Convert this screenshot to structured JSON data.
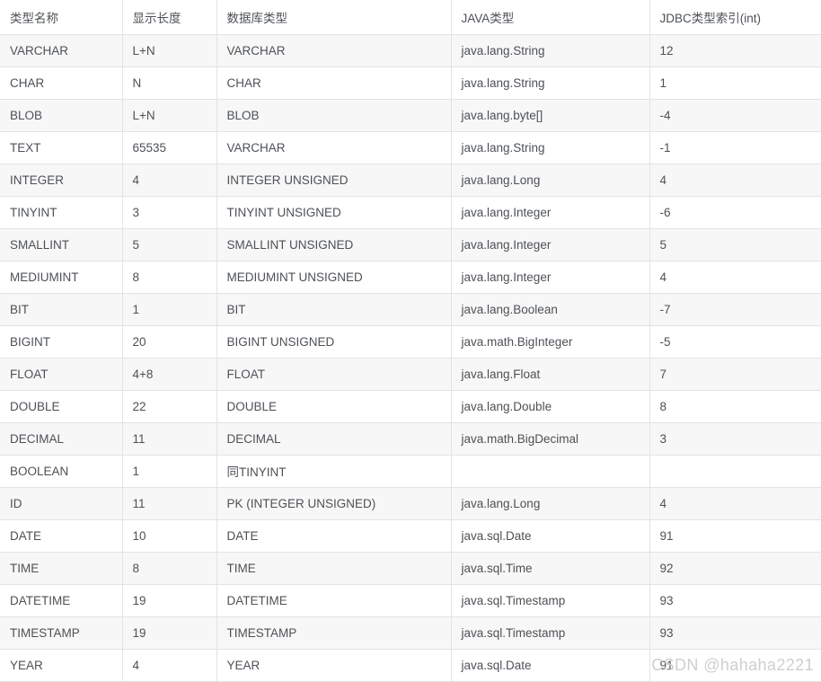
{
  "table": {
    "columns": [
      "类型名称",
      "显示长度",
      "数据库类型",
      "JAVA类型",
      "JDBC类型索引(int)"
    ],
    "rows": [
      {
        "type_name": "VARCHAR",
        "display_length": "L+N",
        "db_type": "VARCHAR",
        "java_type": "java.lang.String",
        "jdbc_index": "12"
      },
      {
        "type_name": "CHAR",
        "display_length": "N",
        "db_type": "CHAR",
        "java_type": "java.lang.String",
        "jdbc_index": "1"
      },
      {
        "type_name": "BLOB",
        "display_length": "L+N",
        "db_type": "BLOB",
        "java_type": "java.lang.byte[]",
        "jdbc_index": "-4"
      },
      {
        "type_name": "TEXT",
        "display_length": "65535",
        "db_type": "VARCHAR",
        "java_type": "java.lang.String",
        "jdbc_index": "-1"
      },
      {
        "type_name": "INTEGER",
        "display_length": "4",
        "db_type": "INTEGER UNSIGNED",
        "java_type": "java.lang.Long",
        "jdbc_index": "4"
      },
      {
        "type_name": "TINYINT",
        "display_length": "3",
        "db_type": "TINYINT UNSIGNED",
        "java_type": "java.lang.Integer",
        "jdbc_index": "-6"
      },
      {
        "type_name": "SMALLINT",
        "display_length": "5",
        "db_type": "SMALLINT UNSIGNED",
        "java_type": "java.lang.Integer",
        "jdbc_index": "5"
      },
      {
        "type_name": "MEDIUMINT",
        "display_length": "8",
        "db_type": "MEDIUMINT UNSIGNED",
        "java_type": "java.lang.Integer",
        "jdbc_index": "4"
      },
      {
        "type_name": "BIT",
        "display_length": "1",
        "db_type": "BIT",
        "java_type": "java.lang.Boolean",
        "jdbc_index": "-7"
      },
      {
        "type_name": "BIGINT",
        "display_length": "20",
        "db_type": "BIGINT UNSIGNED",
        "java_type": "java.math.BigInteger",
        "jdbc_index": "-5"
      },
      {
        "type_name": "FLOAT",
        "display_length": "4+8",
        "db_type": "FLOAT",
        "java_type": "java.lang.Float",
        "jdbc_index": "7"
      },
      {
        "type_name": "DOUBLE",
        "display_length": "22",
        "db_type": "DOUBLE",
        "java_type": "java.lang.Double",
        "jdbc_index": "8"
      },
      {
        "type_name": "DECIMAL",
        "display_length": "11",
        "db_type": "DECIMAL",
        "java_type": "java.math.BigDecimal",
        "jdbc_index": "3"
      },
      {
        "type_name": "BOOLEAN",
        "display_length": "1",
        "db_type": "同TINYINT",
        "java_type": "",
        "jdbc_index": ""
      },
      {
        "type_name": "ID",
        "display_length": "11",
        "db_type": "PK (INTEGER UNSIGNED)",
        "java_type": "java.lang.Long",
        "jdbc_index": "4"
      },
      {
        "type_name": "DATE",
        "display_length": "10",
        "db_type": "DATE",
        "java_type": "java.sql.Date",
        "jdbc_index": "91"
      },
      {
        "type_name": "TIME",
        "display_length": "8",
        "db_type": "TIME",
        "java_type": "java.sql.Time",
        "jdbc_index": "92"
      },
      {
        "type_name": "DATETIME",
        "display_length": "19",
        "db_type": "DATETIME",
        "java_type": "java.sql.Timestamp",
        "jdbc_index": "93"
      },
      {
        "type_name": "TIMESTAMP",
        "display_length": "19",
        "db_type": "TIMESTAMP",
        "java_type": "java.sql.Timestamp",
        "jdbc_index": "93"
      },
      {
        "type_name": "YEAR",
        "display_length": "4",
        "db_type": "YEAR",
        "java_type": "java.sql.Date",
        "jdbc_index": "91"
      }
    ]
  },
  "watermark": {
    "text": "CSDN @hahaha2221"
  },
  "colors": {
    "text": "#4d5156",
    "row_alt_background": "#f7f7f7",
    "row_background": "#ffffff",
    "border": "#e3e3e3",
    "watermark": "#cfcfcf"
  }
}
